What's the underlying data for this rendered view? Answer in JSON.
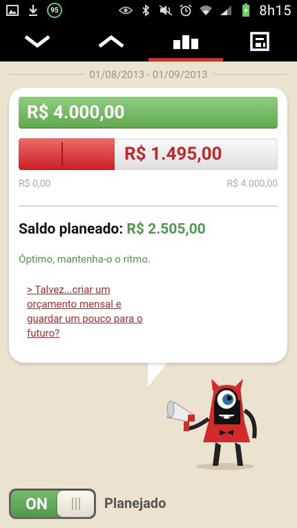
{
  "statusbar": {
    "battery_badge": "95",
    "time": "8h15",
    "icons": [
      "gallery-icon",
      "download-icon",
      "eye-icon",
      "bluetooth-icon",
      "mute-icon",
      "alarm-icon",
      "wifi-icon",
      "signal-icon",
      "battery-charging-icon"
    ]
  },
  "toolbar": {
    "items": [
      "chevron-down-icon",
      "chevron-up-icon",
      "bar-chart-icon",
      "calculator-icon"
    ],
    "active_index": 2
  },
  "period": {
    "label": "01/08/2013 - 01/09/2013"
  },
  "budget": {
    "income_label": "R$ 4.000,00",
    "spent_label": "R$ 1.495,00",
    "spent_fraction": 0.37,
    "scale_min": "R$ 0,00",
    "scale_max": "R$ 4.000,00",
    "saldo_title": "Saldo planeado:",
    "saldo_value": "R$ 2.505,00",
    "tip": "Óptimo, mantenha-o o ritmo.",
    "link": "> Talvez...criar um orçamento mensal e guardar um pouco para o futuro?"
  },
  "toggle": {
    "state": "ON",
    "label": "Planejado"
  },
  "colors": {
    "accent_red": "#d32f2f",
    "income_green": "#5fa94f",
    "spent_red": "#c91f24",
    "background": "#ebe3cf"
  }
}
